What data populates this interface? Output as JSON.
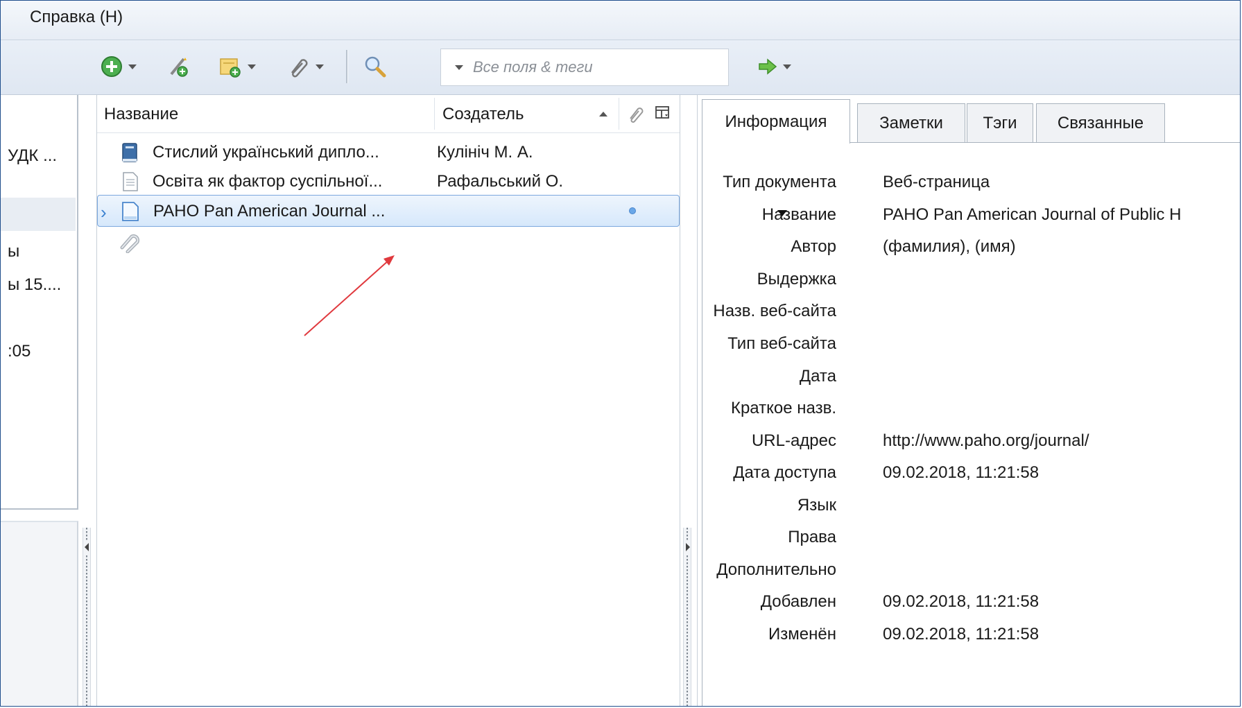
{
  "menu": {
    "help_label": "Справка (H)"
  },
  "toolbar": {
    "search_placeholder": "Все поля & теги"
  },
  "left_pane": {
    "items": [
      "УДК ...",
      "ы",
      "ы 15....",
      ":05"
    ]
  },
  "items_list": {
    "columns": {
      "title": "Название",
      "creator": "Создатель"
    },
    "rows": [
      {
        "title": "Стислий український дипло...",
        "creator": "Кулініч М. А.",
        "icon": "book-icon"
      },
      {
        "title": "Освіта як фактор суспільної...",
        "creator": "Рафальський О.",
        "icon": "document-icon"
      },
      {
        "title": "PAHO Pan American Journal ...",
        "creator": "",
        "icon": "webpage-icon",
        "selected": true
      }
    ]
  },
  "item_pane": {
    "tabs": [
      "Информация",
      "Заметки",
      "Тэги",
      "Связанные"
    ],
    "fields": [
      {
        "label": "Тип документа",
        "value": "Веб-страница"
      },
      {
        "label": "Название",
        "value": "PAHO Pan American Journal of Public H"
      },
      {
        "label": "Автор",
        "value": "(фамилия), (имя)"
      },
      {
        "label": "Выдержка",
        "value": ""
      },
      {
        "label": "Назв. веб-сайта",
        "value": ""
      },
      {
        "label": "Тип веб-сайта",
        "value": ""
      },
      {
        "label": "Дата",
        "value": ""
      },
      {
        "label": "Краткое назв.",
        "value": ""
      },
      {
        "label": "URL-адрес",
        "value": "http://www.paho.org/journal/"
      },
      {
        "label": "Дата доступа",
        "value": "09.02.2018, 11:21:58"
      },
      {
        "label": "Язык",
        "value": ""
      },
      {
        "label": "Права",
        "value": ""
      },
      {
        "label": "Дополнительно",
        "value": ""
      },
      {
        "label": "Добавлен",
        "value": "09.02.2018, 11:21:58"
      },
      {
        "label": "Изменён",
        "value": "09.02.2018, 11:21:58"
      }
    ]
  },
  "colors": {
    "selection_border": "#7aa7de",
    "annotation_arrow": "#e0393e",
    "frame_border": "#1f4e8c"
  }
}
